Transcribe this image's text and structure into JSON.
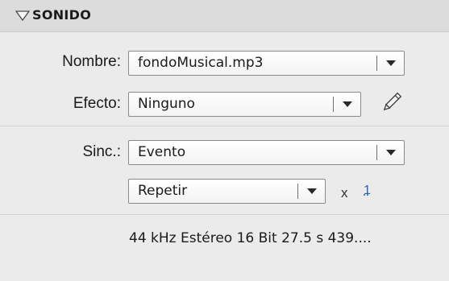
{
  "section": {
    "title": "SONIDO"
  },
  "fields": {
    "nombre_label": "Nombre:",
    "nombre_value": "fondoMusical.mp3",
    "efecto_label": "Efecto:",
    "efecto_value": "Ninguno",
    "sinc_label": "Sinc.:",
    "sinc_value": "Evento",
    "repeat_value": "Repetir",
    "times_symbol": "x",
    "repeat_count": "1"
  },
  "info": {
    "sound_properties": "44 kHz Estéreo 16 Bit 27.5 s 439...."
  },
  "icons": {
    "collapse": "triangle-down-icon",
    "edit": "pencil-icon",
    "dropdown": "chevron-down-icon"
  },
  "colors": {
    "panel_bg": "#ebebeb",
    "header_bg": "#dcdcdc",
    "link": "#2d5fb4"
  }
}
